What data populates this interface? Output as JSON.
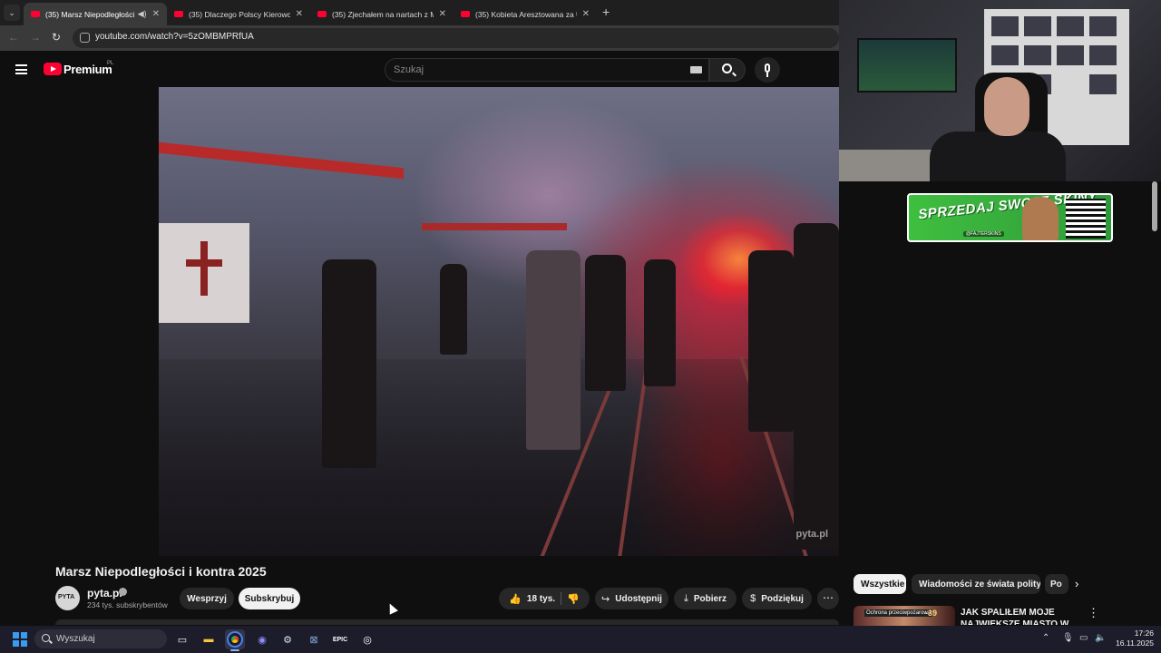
{
  "browser": {
    "tabs": [
      {
        "title": "(35) Marsz Niepodległości i",
        "active": true,
        "audio": true
      },
      {
        "title": "(35) Dlaczego Polscy Kierowcy"
      },
      {
        "title": "(35) Zjechałem na nartach z M"
      },
      {
        "title": "(35) Kobieta Aresztowana za Uj"
      }
    ],
    "url": "youtube.com/watch?v=5zOMBMPRfUA"
  },
  "youtube": {
    "brand": "Premium",
    "region": "PL",
    "search_placeholder": "Szukaj",
    "video": {
      "title": "Marsz Niepodległości i kontra 2025",
      "watermark": "pyta.pl",
      "channel": "pyta.pl",
      "subscribers": "234 tys. subskrybentów",
      "support_label": "Wesprzyj",
      "subscribe_label": "Subskrybuj",
      "likes": "18 tys.",
      "share_label": "Udostępnij",
      "download_label": "Pobierz",
      "thanks_label": "Podziękuj"
    },
    "chips": [
      "Wszystkie",
      "Wiadomości ze świata polityki",
      "Po"
    ],
    "recommendation": {
      "title": "JAK SPALIŁEM MOJE NAJWIĘKSZE MIASTO W ANN",
      "badge": "Ochrona przeciwpożarowa",
      "number": "-39"
    }
  },
  "overlay": {
    "promo_title": "SPRZEDAJ SWOJE SKINY",
    "promo_handle": "@FAJTERSKINS"
  },
  "taskbar": {
    "search_placeholder": "Wyszukaj",
    "time": "17:26",
    "date": "16.11.2025"
  },
  "colors": {
    "youtube_red": "#ff0033",
    "accent_blue": "#3a9cf0"
  }
}
